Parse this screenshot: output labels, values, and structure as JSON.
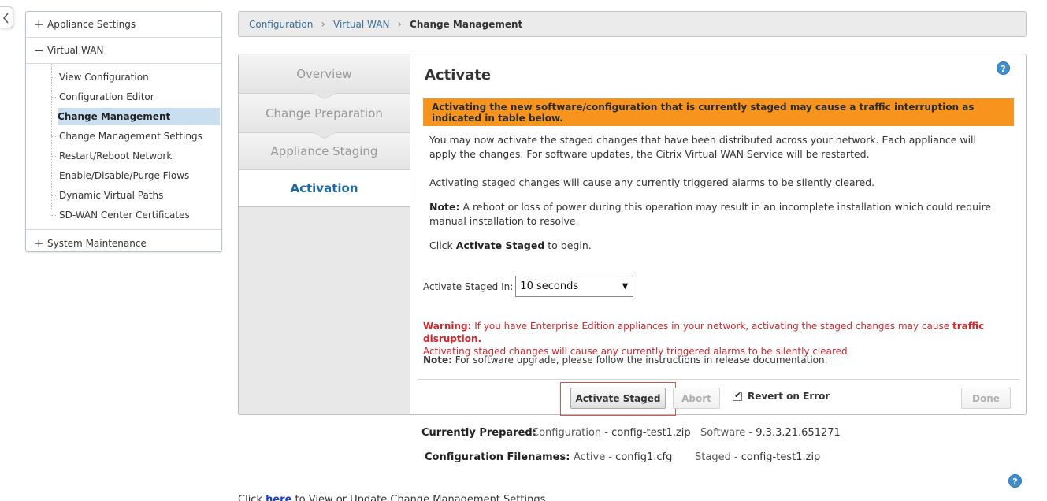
{
  "nav": {
    "appliance_settings": "Appliance Settings",
    "virtual_wan": "Virtual WAN",
    "items": [
      "View Configuration",
      "Configuration Editor",
      "Change Management",
      "Change Management Settings",
      "Restart/Reboot Network",
      "Enable/Disable/Purge Flows",
      "Dynamic Virtual Paths",
      "SD-WAN Center Certificates"
    ],
    "system_maintenance": "System Maintenance"
  },
  "breadcrumb": {
    "configuration": "Configuration",
    "virtual_wan": "Virtual WAN",
    "current": "Change Management"
  },
  "steps": {
    "overview": "Overview",
    "change_preparation": "Change Preparation",
    "appliance_staging": "Appliance Staging",
    "activation": "Activation"
  },
  "content": {
    "title": "Activate",
    "help": "?",
    "warning_banner": "Activating the new software/configuration that is currently staged may cause a traffic interruption as indicated in table below.",
    "para1": "You may now activate the staged changes that have been distributed across your network. Each appliance will apply the changes. For software updates, the Citrix Virtual WAN Service will be restarted.",
    "para2": "Activating staged changes will cause any currently triggered alarms to be silently cleared.",
    "note_label": "Note:",
    "note_text": " A reboot or loss of power during this operation may result in an incomplete installation which could require manual installation to resolve.",
    "click_pre": "Click ",
    "click_bold": "Activate Staged",
    "click_post": " to begin.",
    "activate_in_label": "Activate Staged In:",
    "activate_in_value": "10 seconds",
    "warning_label": "Warning:",
    "warning_text": " If you have Enterprise Edition appliances in your network, activating the staged changes may cause ",
    "warning_bold": "traffic disruption.",
    "warning_line2": "Activating staged changes will cause any currently triggered alarms to be silently cleared",
    "note2_label": "Note:",
    "note2_text": " For software upgrade, please follow the instructions in release documentation."
  },
  "buttons": {
    "activate_staged": "Activate Staged",
    "abort": "Abort",
    "revert_on_error": "Revert on Error",
    "done": "Done"
  },
  "info": {
    "currently_prepared_label": "Currently Prepared:",
    "config_prefix": "Configuration - ",
    "config_file": "config-test1.zip",
    "software_prefix": "Software - ",
    "software_version": "9.3.3.21.651271",
    "filenames_label": "Configuration Filenames:",
    "active_prefix": "Active - ",
    "active_file": "config1.cfg",
    "staged_prefix": "Staged - ",
    "staged_file": "config-test1.zip"
  },
  "bottom": {
    "pre": "Click ",
    "link": "here",
    "post": " to View or Update Change Management Settings"
  },
  "colors": {
    "warning_banner": "#f7941d",
    "warning_text": "#d0262d",
    "active_step": "#1c6aa3",
    "nav_selected": "#c9dfef"
  }
}
